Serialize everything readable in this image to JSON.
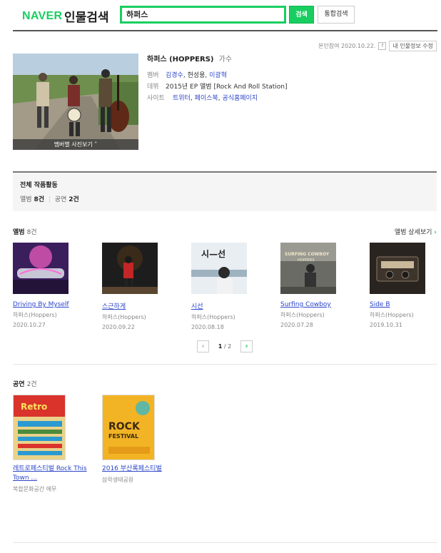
{
  "header": {
    "logo": "NAVER",
    "title": "인물검색",
    "search_value": "하퍼스",
    "search_button": "검색",
    "total_button": "통합검색"
  },
  "meta": {
    "updated": "본인참여 2020.10.22.",
    "help": "?",
    "edit_button": "내 인물정보 수정"
  },
  "profile": {
    "photo_caption": "멤버별 사진보기 ˅",
    "name": "하퍼스 (HOPPERS)",
    "role": "가수",
    "rows": [
      {
        "label": "멤버",
        "parts": [
          "김경수",
          ", 현성용, ",
          "이광혁"
        ]
      },
      {
        "label": "데뷔",
        "value": "2015년 EP 앨범 [Rock And Roll Station]"
      },
      {
        "label": "사이트",
        "links": [
          "트위터",
          "페이스북",
          "공식홈페이지"
        ]
      }
    ]
  },
  "summary": {
    "title": "전체 작품활동",
    "album_label": "앨범",
    "album_count": "8건",
    "show_label": "공연",
    "show_count": "2건"
  },
  "albums_section": {
    "title": "앨범",
    "count": "8건",
    "more": "앨범 상세보기",
    "items": [
      {
        "title": "Driving By Myself",
        "artist": "하퍼스(Hoppers)",
        "date": "2020.10.27"
      },
      {
        "title": "스근하게",
        "artist": "하퍼스(Hoppers)",
        "date": "2020.09.22"
      },
      {
        "title": "시선",
        "artist": "하퍼스(Hoppers)",
        "date": "2020.08.18"
      },
      {
        "title": "Surfing Cowboy",
        "artist": "하퍼스(Hoppers)",
        "date": "2020.07.28"
      },
      {
        "title": "Side B",
        "artist": "하퍼스(Hoppers)",
        "date": "2019.10.31"
      }
    ],
    "pager": {
      "current": "1",
      "total": "2"
    }
  },
  "shows_section": {
    "title": "공연",
    "count": "2건",
    "items": [
      {
        "title": "레트로페스티벌 Rock This Town ...",
        "venue": "복합문화공간 에무"
      },
      {
        "title": "2016 부산록페스티벌",
        "venue": "삼락생태공원"
      }
    ]
  },
  "cover_text": {
    "album3": "시—선",
    "album4": "SURFING COWBOY",
    "album4_sub": "HOPPERS",
    "show1": "Retro",
    "show2_line1": "ROCK",
    "show2_line2": "FESTIVAL"
  },
  "colors": {
    "naver_green": "#19ce60",
    "link_blue": "#2b45c9"
  }
}
